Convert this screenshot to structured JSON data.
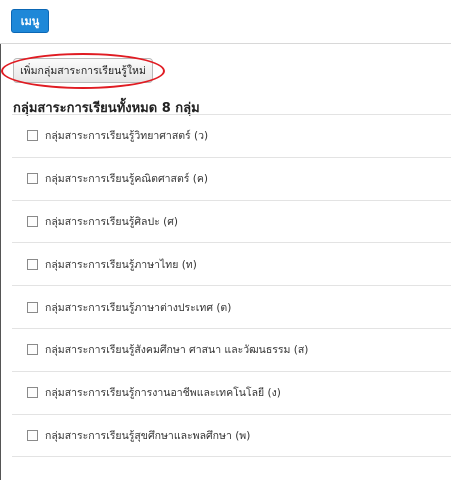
{
  "header": {
    "menu_label": "เมนู"
  },
  "actions": {
    "add_button_label": "เพิ่มกลุ่มสาระการเรียนรู้ใหม่"
  },
  "section": {
    "title": "กลุ่มสาระการเรียนทั้งหมด 8 กลุ่ม"
  },
  "subjects": [
    {
      "label": "กลุ่มสาระการเรียนรู้วิทยาศาสตร์ (ว)",
      "checked": false
    },
    {
      "label": "กลุ่มสาระการเรียนรู้คณิตศาสตร์ (ค)",
      "checked": false
    },
    {
      "label": "กลุ่มสาระการเรียนรู้ศิลปะ (ศ)",
      "checked": false
    },
    {
      "label": "กลุ่มสาระการเรียนรู้ภาษาไทย (ท)",
      "checked": false
    },
    {
      "label": "กลุ่มสาระการเรียนรู้ภาษาต่างประเทศ (ต)",
      "checked": false
    },
    {
      "label": "กลุ่มสาระการเรียนรู้สังคมศึกษา ศาสนา และวัฒนธรรม (ส)",
      "checked": false
    },
    {
      "label": "กลุ่มสาระการเรียนรู้การงานอาชีพและเทคโนโลยี (ง)",
      "checked": false
    },
    {
      "label": "กลุ่มสาระการเรียนรู้สุขศึกษาและพลศึกษา (พ)",
      "checked": false
    }
  ],
  "colors": {
    "menu_button": "#1e88d8",
    "highlight_oval": "#e01b22"
  }
}
